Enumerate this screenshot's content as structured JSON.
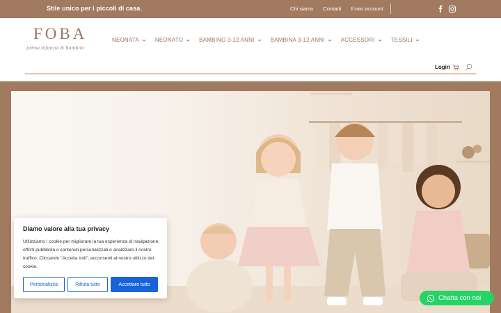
{
  "topbar": {
    "tagline": "Stile unico per i piccoli di casa.",
    "links": [
      "Chi siamo",
      "Contatti",
      "Il mio account"
    ],
    "social": [
      "facebook-icon",
      "instagram-icon"
    ],
    "bg_color": "#a17a60"
  },
  "logo": {
    "wordmark": "FOBA",
    "subtitle": "prima infanzia & bambini"
  },
  "nav": {
    "items": [
      "NEONATA",
      "NEONATO",
      "BAMBINO 3-12 ANNI",
      "BAMBINA 3-12 ANNI",
      "ACCESSORI",
      "TESSILI"
    ]
  },
  "header": {
    "login_label": "Login",
    "cart_icon": "cart-icon",
    "search_icon": "search-icon"
  },
  "cookie": {
    "title": "Diamo valore alla tua privacy",
    "body": "Utilizziamo i cookie per migliorare la tua esperienza di navigazione, offrirti pubblicità o contenuti personalizzati e analizzare il nostro traffico. Cliccando \"Accetta tutti\", acconsenti al nostro utilizzo dei cookie.",
    "customize_label": "Personalizza",
    "reject_label": "Rifiuta tutto",
    "accept_label": "Accettare tutto",
    "accent_color": "#1863dc"
  },
  "chat": {
    "label": "Chatta con noi",
    "color": "#25d366"
  }
}
